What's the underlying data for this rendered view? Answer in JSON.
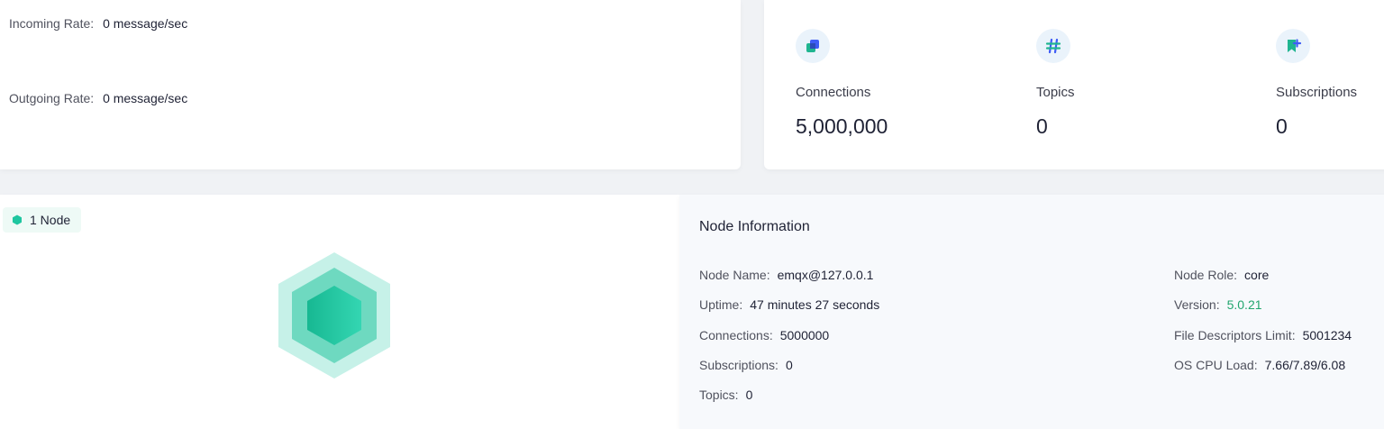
{
  "rates": {
    "incoming_label": "Incoming Rate:",
    "incoming_value": "0 message/sec",
    "outgoing_label": "Outgoing Rate:",
    "outgoing_value": "0 message/sec"
  },
  "stats": [
    {
      "icon": "connections-icon",
      "label": "Connections",
      "value": "5,000,000"
    },
    {
      "icon": "hash-icon",
      "label": "Topics",
      "value": "0"
    },
    {
      "icon": "subscription-icon",
      "label": "Subscriptions",
      "value": "0"
    }
  ],
  "nodes": {
    "badge_label": "1 Node"
  },
  "node_info": {
    "title": "Node Information",
    "left": [
      {
        "key": "Node Name:",
        "value": "emqx@127.0.0.1"
      },
      {
        "key": "Uptime:",
        "value": "47 minutes 27 seconds"
      },
      {
        "key": "Connections:",
        "value": "5000000"
      },
      {
        "key": "Subscriptions:",
        "value": "0"
      },
      {
        "key": "Topics:",
        "value": "0"
      }
    ],
    "right": [
      {
        "key": "Node Role:",
        "value": "core"
      },
      {
        "key": "Version:",
        "value": "5.0.21"
      },
      {
        "key": "File Descriptors Limit:",
        "value": "5001234"
      },
      {
        "key": "OS CPU Load:",
        "value": "7.66/7.89/6.08"
      }
    ]
  },
  "colors": {
    "accent_green": "#22a66e",
    "hex_light": "#c6f1e8",
    "hex_mid": "#6ed9c0",
    "hex_dark": "#1fc6a0",
    "icon_blue": "#3d5cf5",
    "icon_teal": "#1fb590"
  }
}
